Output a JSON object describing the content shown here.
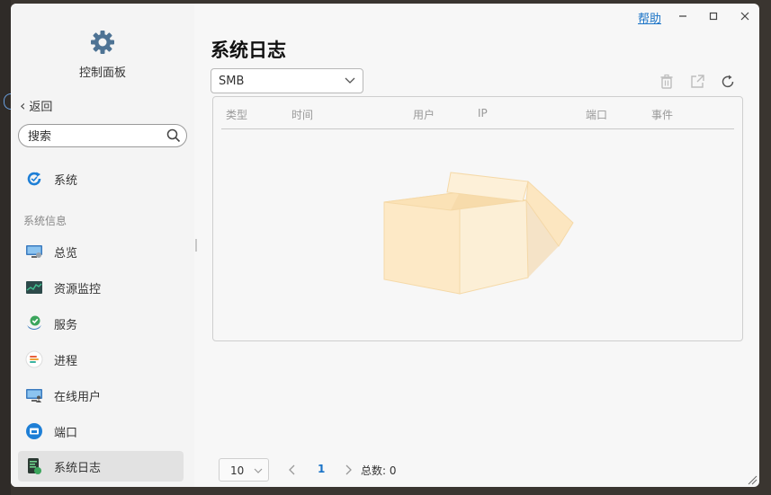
{
  "app": {
    "title": "控制面板"
  },
  "window": {
    "help": "帮助"
  },
  "sidebar": {
    "back": "返回",
    "search_placeholder": "搜索",
    "section": "系统信息",
    "items": [
      {
        "label": "系统",
        "icon": "system-sync-icon"
      },
      {
        "label": "总览",
        "icon": "monitor-icon"
      },
      {
        "label": "资源监控",
        "icon": "resource-monitor-icon"
      },
      {
        "label": "服务",
        "icon": "service-check-icon"
      },
      {
        "label": "进程",
        "icon": "process-list-icon"
      },
      {
        "label": "在线用户",
        "icon": "online-user-icon"
      },
      {
        "label": "端口",
        "icon": "port-icon"
      },
      {
        "label": "系统日志",
        "icon": "system-log-icon"
      }
    ]
  },
  "main": {
    "title": "系统日志",
    "filter": {
      "selected": "SMB"
    },
    "columns": [
      "类型",
      "时间",
      "用户",
      "IP",
      "端口",
      "事件"
    ],
    "rows": []
  },
  "pager": {
    "page_size": "10",
    "current_page": "1",
    "total": "总数: 0"
  },
  "colors": {
    "accent": "#1a73c7",
    "active_item_bg": "#e2e2e2",
    "empty_box": "#fde9c6"
  }
}
